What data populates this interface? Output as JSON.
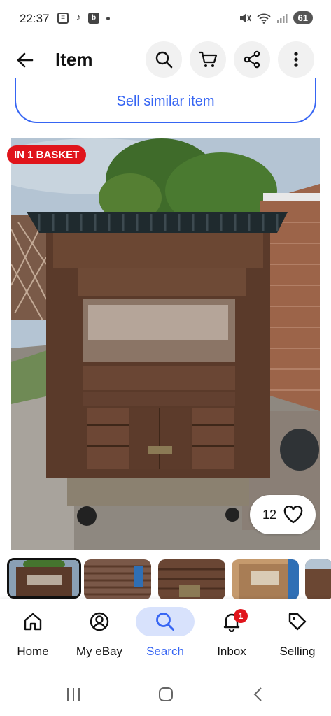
{
  "status_bar": {
    "time": "22:37",
    "battery": "61"
  },
  "header": {
    "title": "Item"
  },
  "sell_similar": {
    "label": "Sell similar item"
  },
  "listing": {
    "basket_badge": "IN 1 BASKET",
    "watch_count": "12"
  },
  "thumbnails": [
    "hutch-front",
    "hutch-side",
    "hutch-door",
    "hutch-open",
    "hutch-top"
  ],
  "bottom_nav": {
    "items": [
      {
        "label": "Home",
        "icon": "home-icon"
      },
      {
        "label": "My eBay",
        "icon": "account-icon"
      },
      {
        "label": "Search",
        "icon": "search-icon"
      },
      {
        "label": "Inbox",
        "icon": "bell-icon",
        "badge": "1"
      },
      {
        "label": "Selling",
        "icon": "tag-icon"
      }
    ]
  },
  "colors": {
    "accent": "#3665f3",
    "badge_red": "#e0141b"
  }
}
